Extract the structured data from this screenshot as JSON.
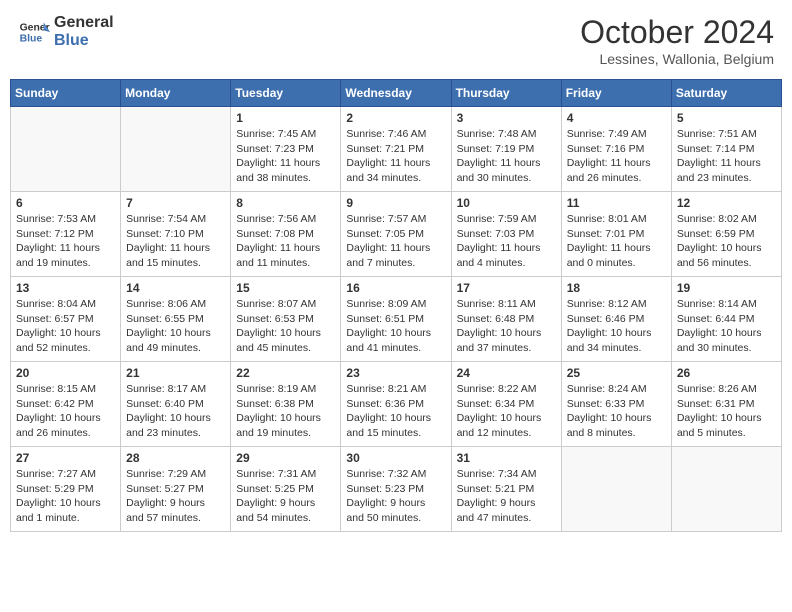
{
  "header": {
    "logo_line1": "General",
    "logo_line2": "Blue",
    "month": "October 2024",
    "location": "Lessines, Wallonia, Belgium"
  },
  "days_of_week": [
    "Sunday",
    "Monday",
    "Tuesday",
    "Wednesday",
    "Thursday",
    "Friday",
    "Saturday"
  ],
  "weeks": [
    [
      {
        "day": "",
        "empty": true
      },
      {
        "day": "",
        "empty": true
      },
      {
        "day": "1",
        "sunrise": "7:45 AM",
        "sunset": "7:23 PM",
        "daylight": "11 hours and 38 minutes."
      },
      {
        "day": "2",
        "sunrise": "7:46 AM",
        "sunset": "7:21 PM",
        "daylight": "11 hours and 34 minutes."
      },
      {
        "day": "3",
        "sunrise": "7:48 AM",
        "sunset": "7:19 PM",
        "daylight": "11 hours and 30 minutes."
      },
      {
        "day": "4",
        "sunrise": "7:49 AM",
        "sunset": "7:16 PM",
        "daylight": "11 hours and 26 minutes."
      },
      {
        "day": "5",
        "sunrise": "7:51 AM",
        "sunset": "7:14 PM",
        "daylight": "11 hours and 23 minutes."
      }
    ],
    [
      {
        "day": "6",
        "sunrise": "7:53 AM",
        "sunset": "7:12 PM",
        "daylight": "11 hours and 19 minutes."
      },
      {
        "day": "7",
        "sunrise": "7:54 AM",
        "sunset": "7:10 PM",
        "daylight": "11 hours and 15 minutes."
      },
      {
        "day": "8",
        "sunrise": "7:56 AM",
        "sunset": "7:08 PM",
        "daylight": "11 hours and 11 minutes."
      },
      {
        "day": "9",
        "sunrise": "7:57 AM",
        "sunset": "7:05 PM",
        "daylight": "11 hours and 7 minutes."
      },
      {
        "day": "10",
        "sunrise": "7:59 AM",
        "sunset": "7:03 PM",
        "daylight": "11 hours and 4 minutes."
      },
      {
        "day": "11",
        "sunrise": "8:01 AM",
        "sunset": "7:01 PM",
        "daylight": "11 hours and 0 minutes."
      },
      {
        "day": "12",
        "sunrise": "8:02 AM",
        "sunset": "6:59 PM",
        "daylight": "10 hours and 56 minutes."
      }
    ],
    [
      {
        "day": "13",
        "sunrise": "8:04 AM",
        "sunset": "6:57 PM",
        "daylight": "10 hours and 52 minutes."
      },
      {
        "day": "14",
        "sunrise": "8:06 AM",
        "sunset": "6:55 PM",
        "daylight": "10 hours and 49 minutes."
      },
      {
        "day": "15",
        "sunrise": "8:07 AM",
        "sunset": "6:53 PM",
        "daylight": "10 hours and 45 minutes."
      },
      {
        "day": "16",
        "sunrise": "8:09 AM",
        "sunset": "6:51 PM",
        "daylight": "10 hours and 41 minutes."
      },
      {
        "day": "17",
        "sunrise": "8:11 AM",
        "sunset": "6:48 PM",
        "daylight": "10 hours and 37 minutes."
      },
      {
        "day": "18",
        "sunrise": "8:12 AM",
        "sunset": "6:46 PM",
        "daylight": "10 hours and 34 minutes."
      },
      {
        "day": "19",
        "sunrise": "8:14 AM",
        "sunset": "6:44 PM",
        "daylight": "10 hours and 30 minutes."
      }
    ],
    [
      {
        "day": "20",
        "sunrise": "8:15 AM",
        "sunset": "6:42 PM",
        "daylight": "10 hours and 26 minutes."
      },
      {
        "day": "21",
        "sunrise": "8:17 AM",
        "sunset": "6:40 PM",
        "daylight": "10 hours and 23 minutes."
      },
      {
        "day": "22",
        "sunrise": "8:19 AM",
        "sunset": "6:38 PM",
        "daylight": "10 hours and 19 minutes."
      },
      {
        "day": "23",
        "sunrise": "8:21 AM",
        "sunset": "6:36 PM",
        "daylight": "10 hours and 15 minutes."
      },
      {
        "day": "24",
        "sunrise": "8:22 AM",
        "sunset": "6:34 PM",
        "daylight": "10 hours and 12 minutes."
      },
      {
        "day": "25",
        "sunrise": "8:24 AM",
        "sunset": "6:33 PM",
        "daylight": "10 hours and 8 minutes."
      },
      {
        "day": "26",
        "sunrise": "8:26 AM",
        "sunset": "6:31 PM",
        "daylight": "10 hours and 5 minutes."
      }
    ],
    [
      {
        "day": "27",
        "sunrise": "7:27 AM",
        "sunset": "5:29 PM",
        "daylight": "10 hours and 1 minute."
      },
      {
        "day": "28",
        "sunrise": "7:29 AM",
        "sunset": "5:27 PM",
        "daylight": "9 hours and 57 minutes."
      },
      {
        "day": "29",
        "sunrise": "7:31 AM",
        "sunset": "5:25 PM",
        "daylight": "9 hours and 54 minutes."
      },
      {
        "day": "30",
        "sunrise": "7:32 AM",
        "sunset": "5:23 PM",
        "daylight": "9 hours and 50 minutes."
      },
      {
        "day": "31",
        "sunrise": "7:34 AM",
        "sunset": "5:21 PM",
        "daylight": "9 hours and 47 minutes."
      },
      {
        "day": "",
        "empty": true
      },
      {
        "day": "",
        "empty": true
      }
    ]
  ]
}
